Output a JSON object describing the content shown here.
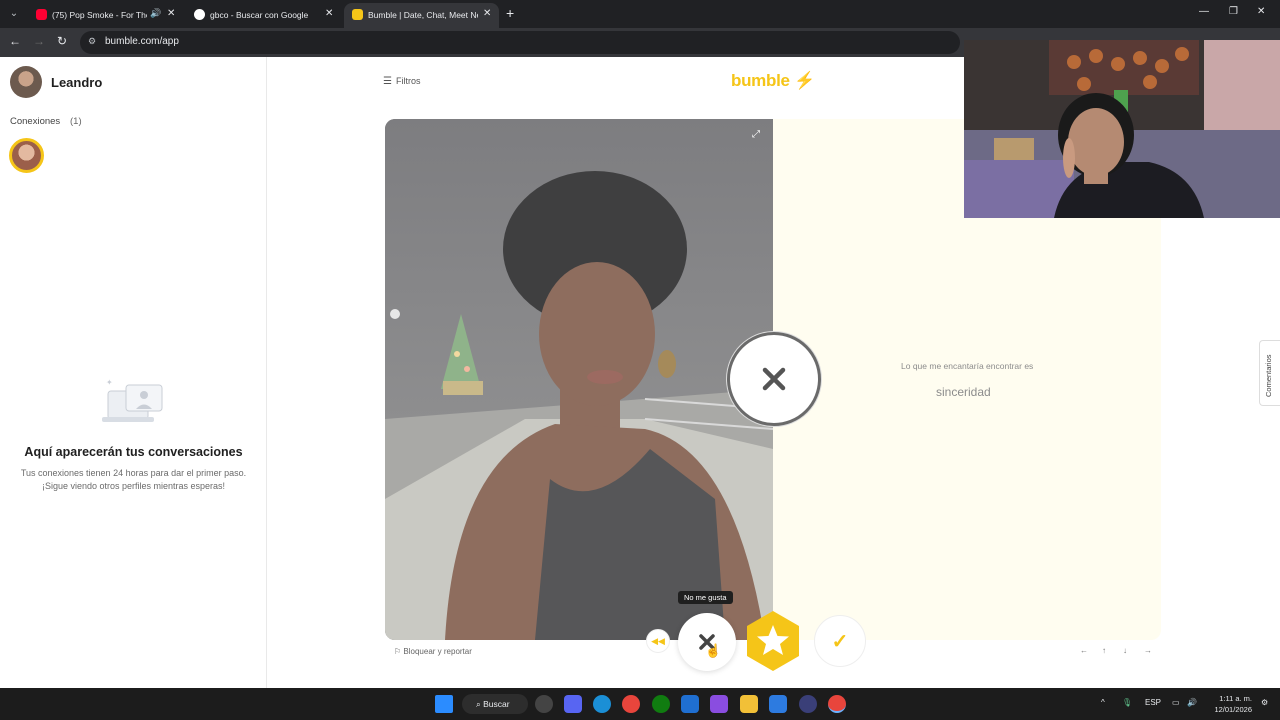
{
  "browser": {
    "tabs": [
      {
        "title": "(75) Pop Smoke - For The N",
        "favicon_color": "#ff0033",
        "active": false
      },
      {
        "title": "gbco - Buscar con Google",
        "favicon_color": "#ffffff",
        "active": false
      },
      {
        "title": "Bumble | Date, Chat, Meet New",
        "favicon_color": "#f5c518",
        "active": true
      }
    ],
    "url": "bumble.com/app"
  },
  "sidebar": {
    "user_name": "Leandro",
    "connections_label": "Conexiones",
    "connections_count": "(1)",
    "empty_title": "Aquí aparecerán tus conversaciones",
    "empty_line1": "Tus conexiones tienen 24 horas para dar el primer paso.",
    "empty_line2": "¡Sigue viendo otros perfiles mientras esperas!"
  },
  "main": {
    "filters_label": "Filtros",
    "logo": "bumble",
    "prompt_label": "Lo que me encantaría encontrar es",
    "prompt_answer": "sinceridad",
    "tooltip": "No me gusta",
    "block_report": "Bloquear y reportar",
    "comments_tab": "Comentarios",
    "keyboard_hints": [
      "←",
      "↑",
      "↓",
      "→"
    ]
  },
  "taskbar": {
    "search_label": "Buscar",
    "language": "ESP",
    "time": "1:11 a. m.",
    "date": "12/01/2026"
  },
  "colors": {
    "brand_yellow": "#f5c518",
    "info_card_bg": "#fffdf0"
  }
}
